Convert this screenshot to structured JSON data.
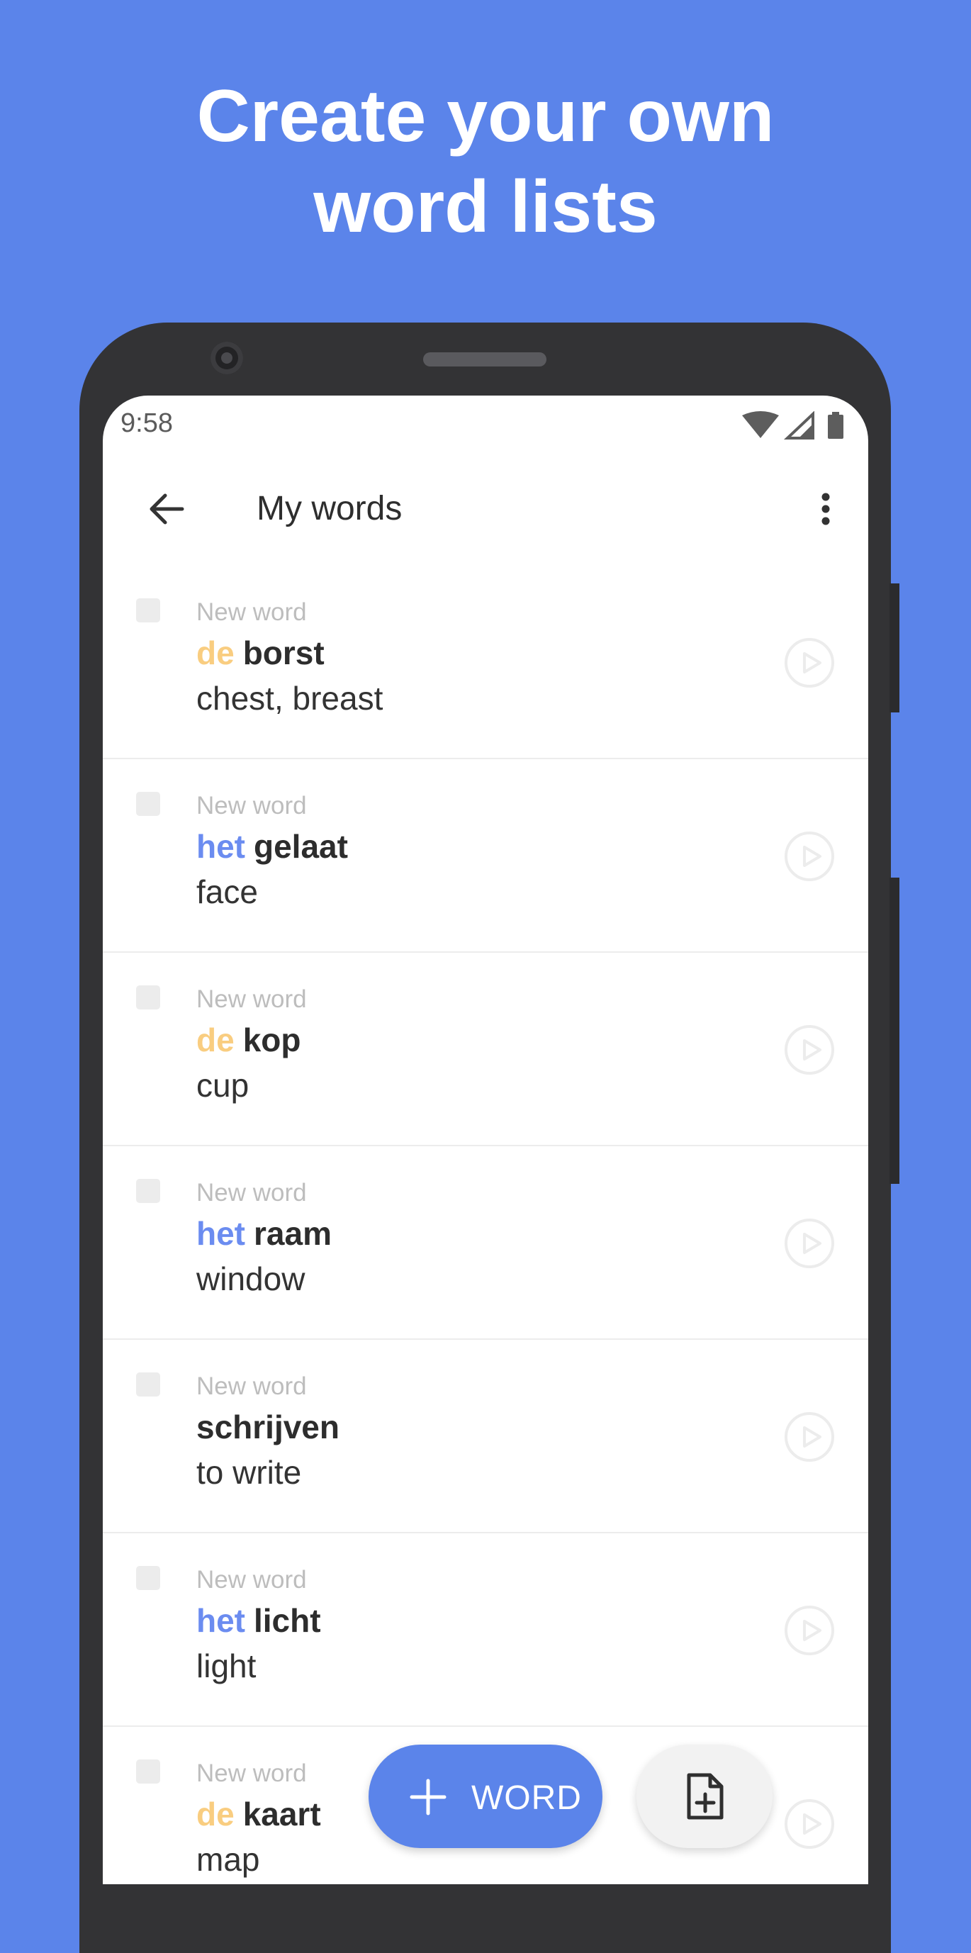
{
  "headline": {
    "line1": "Create your own",
    "line2": "word lists"
  },
  "status_bar": {
    "time": "9:58",
    "icons": [
      "wifi-icon",
      "signal-icon",
      "battery-icon"
    ]
  },
  "toolbar": {
    "title": "My words",
    "back_icon": "arrow-left-icon",
    "menu_icon": "more-vertical-icon"
  },
  "words": [
    {
      "label": "New word",
      "article": "de",
      "word": "borst",
      "translation": "chest, breast"
    },
    {
      "label": "New word",
      "article": "het",
      "word": "gelaat",
      "translation": "face"
    },
    {
      "label": "New word",
      "article": "de",
      "word": "kop",
      "translation": "cup"
    },
    {
      "label": "New word",
      "article": "het",
      "word": "raam",
      "translation": "window"
    },
    {
      "label": "New word",
      "article": "",
      "word": "schrijven",
      "translation": "to write"
    },
    {
      "label": "New word",
      "article": "het",
      "word": "licht",
      "translation": "light"
    },
    {
      "label": "New word",
      "article": "de",
      "word": "kaart",
      "translation": "map"
    }
  ],
  "fab": {
    "add_word_label": "WORD",
    "add_word_icon": "plus-icon",
    "import_icon": "file-add-icon"
  },
  "colors": {
    "background": "#5b84ea",
    "article_de": "#f9cd80",
    "article_het": "#6b8cf0",
    "fab": "#5b84ea"
  }
}
